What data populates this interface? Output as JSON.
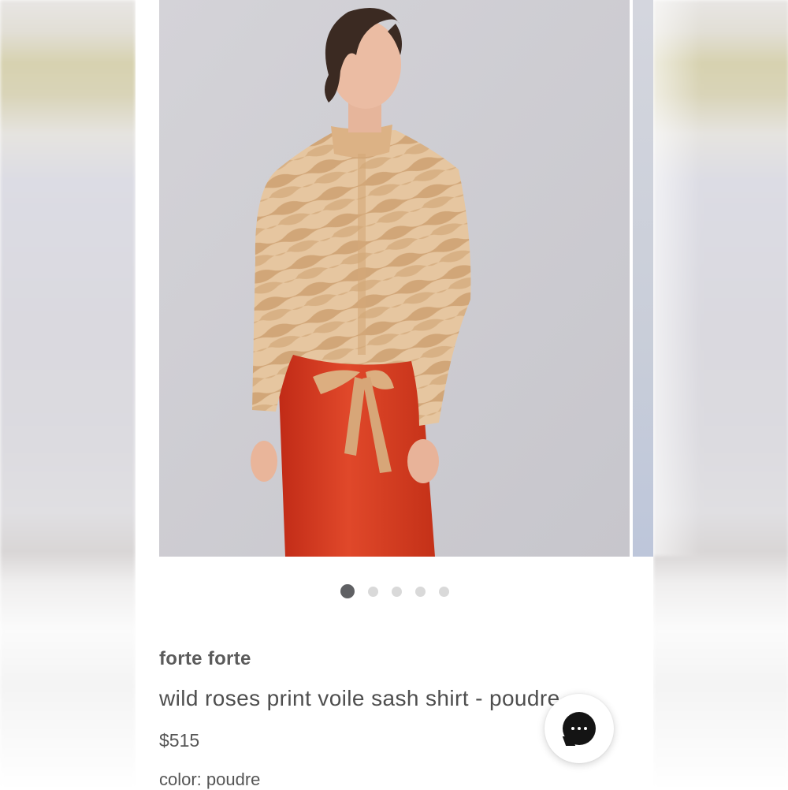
{
  "product": {
    "brand": "forte forte",
    "title": "wild roses print voile sash shirt - poudre",
    "price": "$515",
    "color_label": "color: poudre"
  },
  "carousel": {
    "slide_count": 5,
    "active_index": 0
  },
  "colors": {
    "photo_background": "#cfcfd3",
    "blouse": "#e4bd93",
    "pants": "#d8371f",
    "dot_active": "#5f6063",
    "dot_inactive": "#d9d9d9",
    "text": "#555555",
    "chat_button": "#141414"
  },
  "icons": {
    "chat": "chat-bubble-icon"
  }
}
